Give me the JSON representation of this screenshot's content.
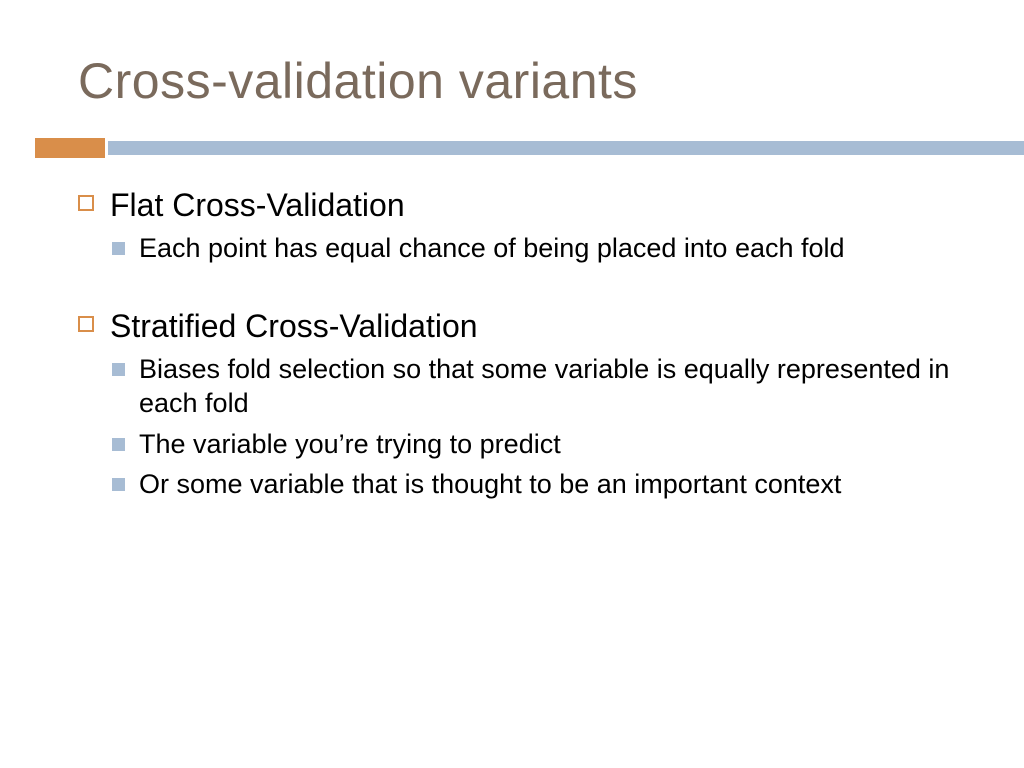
{
  "title": "Cross-validation variants",
  "sections": [
    {
      "heading": "Flat Cross-Validation",
      "sub": [
        "Each point has equal chance of being placed into each fold"
      ]
    },
    {
      "heading": "Stratified Cross-Validation",
      "sub": [
        "Biases fold selection so that some variable is equally represented in each fold",
        "The variable you’re trying to predict",
        "Or some variable that is thought to be an important context"
      ]
    }
  ]
}
